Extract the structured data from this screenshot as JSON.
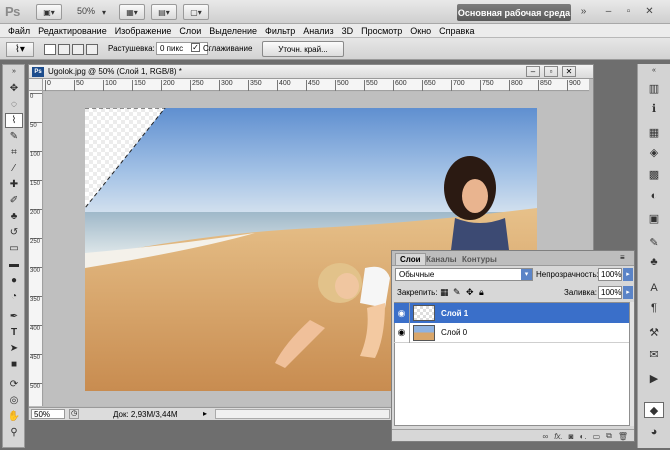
{
  "app": {
    "logo": "Ps",
    "zoom": "50%",
    "workspace": "Основная рабочая среда",
    "window_controls": [
      "minimize-icon",
      "restore-icon",
      "close-icon"
    ]
  },
  "menu": [
    "Файл",
    "Редактирование",
    "Изображение",
    "Слои",
    "Выделение",
    "Фильтр",
    "Анализ",
    "3D",
    "Просмотр",
    "Окно",
    "Справка"
  ],
  "options": {
    "feather_label": "Растушевка:",
    "feather_value": "0 пикс",
    "antialias_label": "Сглаживание",
    "antialias_checked": true,
    "refine_edge": "Уточн. край..."
  },
  "document": {
    "title": "Ugolok.jpg @ 50% (Слой 1, RGB/8) *",
    "ruler_top": [
      "0",
      "50",
      "100",
      "150",
      "200",
      "250",
      "300",
      "350",
      "400",
      "450",
      "500",
      "550",
      "600",
      "650",
      "700",
      "750",
      "800",
      "850",
      "900"
    ],
    "ruler_left": [
      "0",
      "50",
      "100",
      "150",
      "200",
      "250",
      "300",
      "350",
      "400",
      "450",
      "500"
    ],
    "zoom": "50%",
    "doc_size": "Док: 2,93M/3,44M"
  },
  "layers_panel": {
    "tabs": [
      "Слои",
      "Каналы",
      "Контуры"
    ],
    "blend_mode": "Обычные",
    "opacity_label": "Непрозрачность:",
    "opacity_value": "100%",
    "lock_label": "Закрепить:",
    "fill_label": "Заливка:",
    "fill_value": "100%",
    "layers": [
      {
        "name": "Слой 1",
        "selected": true,
        "visible": true
      },
      {
        "name": "Слой 0",
        "selected": false,
        "visible": true
      }
    ],
    "footer_icons": [
      "link-icon",
      "fx-icon",
      "mask-icon",
      "adjustment-icon",
      "folder-icon",
      "new-layer-icon",
      "trash-icon"
    ]
  },
  "colors": {
    "selection_accent": "#3a6fc9",
    "workspace_button": "#656565",
    "panel_bg": "#d7d7d7"
  }
}
